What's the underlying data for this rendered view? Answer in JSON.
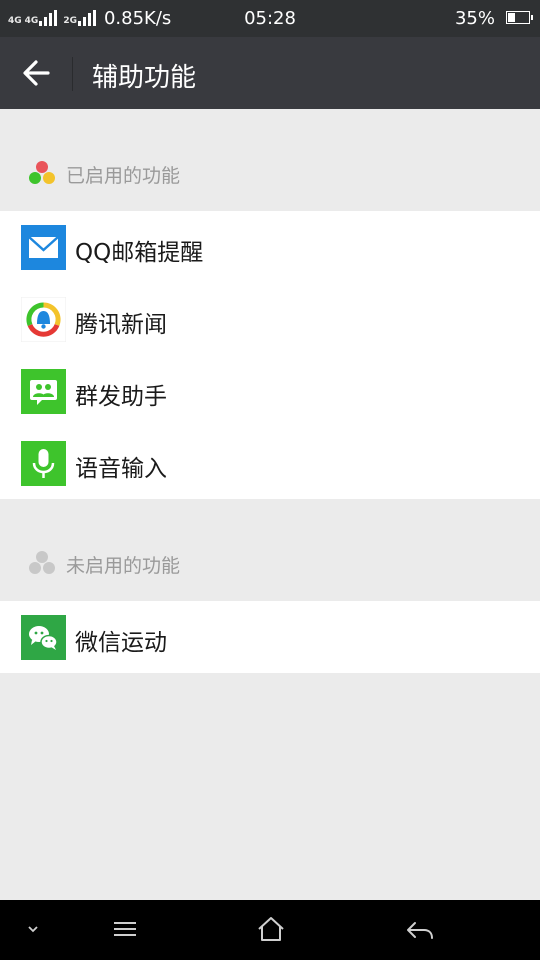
{
  "status_bar": {
    "net1": "4G",
    "net2": "4G",
    "net3": "2G",
    "net_speed": "0.85K/s",
    "time": "05:28",
    "battery": "35%",
    "battery_level": 0.35
  },
  "header": {
    "title": "辅助功能",
    "back_icon": "arrow-left-icon"
  },
  "enabled_section": {
    "label": "已启用的功能",
    "items": [
      {
        "label": "QQ邮箱提醒",
        "icon": "mail-icon",
        "color": "#1d87de"
      },
      {
        "label": "腾讯新闻",
        "icon": "tencent-news-icon",
        "color": "#ffffff"
      },
      {
        "label": "群发助手",
        "icon": "group-message-icon",
        "color": "#3ec42c"
      },
      {
        "label": "语音输入",
        "icon": "microphone-icon",
        "color": "#3ec42c"
      }
    ]
  },
  "disabled_section": {
    "label": "未启用的功能",
    "items": [
      {
        "label": "微信运动",
        "icon": "wechat-icon",
        "color": "#2fa745"
      }
    ]
  },
  "nav_bar": {
    "icons": [
      "chevron-down-icon",
      "menu-icon",
      "home-icon",
      "back-icon"
    ]
  },
  "colors": {
    "title_bar": "#393a3f",
    "status_bar": "#2f3133",
    "page_bg": "#ebebeb",
    "section_text": "#9a9a9a"
  }
}
